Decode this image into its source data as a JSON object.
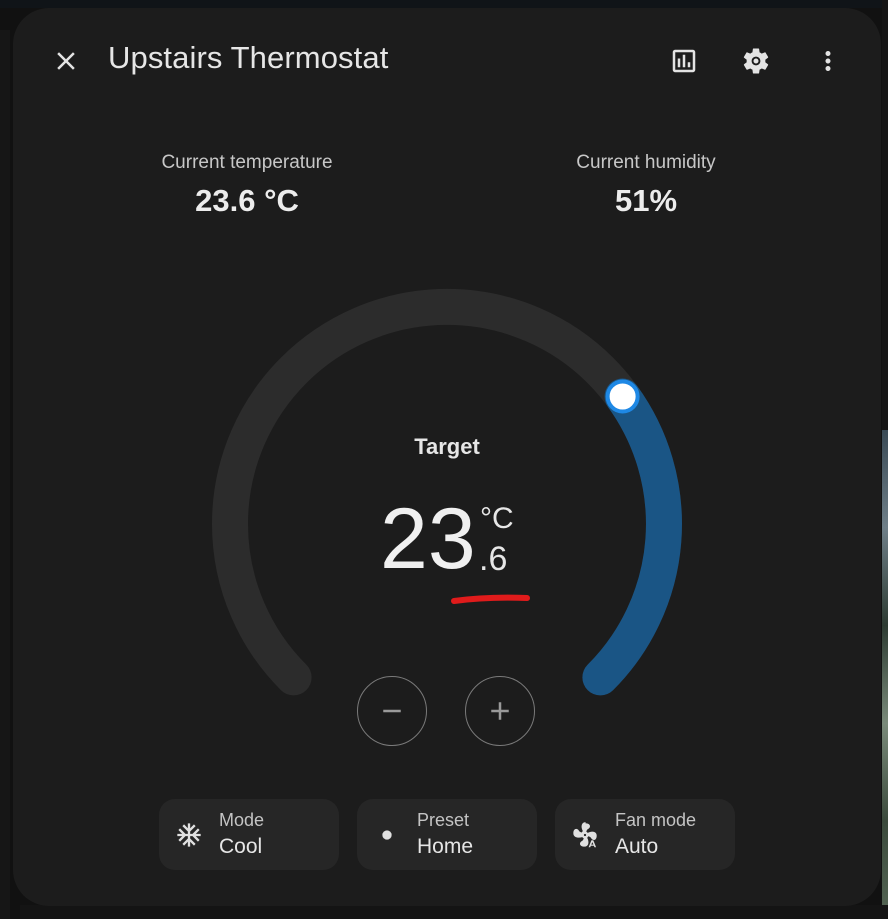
{
  "dialog": {
    "title": "Upstairs Thermostat",
    "icons": {
      "close": "close-icon",
      "history": "chart-box-icon",
      "settings": "gear-icon",
      "more": "dots-vertical-icon"
    }
  },
  "info": {
    "current_temperature_label": "Current temperature",
    "current_temperature_value": "23.6 °C",
    "current_humidity_label": "Current humidity",
    "current_humidity_value": "51%"
  },
  "target": {
    "label": "Target",
    "integer": "23",
    "decimal": ".6",
    "unit": "°C",
    "setpoint_fraction": 0.3,
    "active_color": "#1a5585",
    "track_color": "#2c2c2c",
    "handle_color": "#1e88e5",
    "annotation_color": "#e01b1b"
  },
  "controls": {
    "decrease_icon": "minus-icon",
    "increase_icon": "plus-icon"
  },
  "chips": [
    {
      "label": "Mode",
      "value": "Cool",
      "icon": "snowflake-icon"
    },
    {
      "label": "Preset",
      "value": "Home",
      "icon": "dot-icon"
    },
    {
      "label": "Fan mode",
      "value": "Auto",
      "icon": "fan-auto-icon"
    }
  ]
}
